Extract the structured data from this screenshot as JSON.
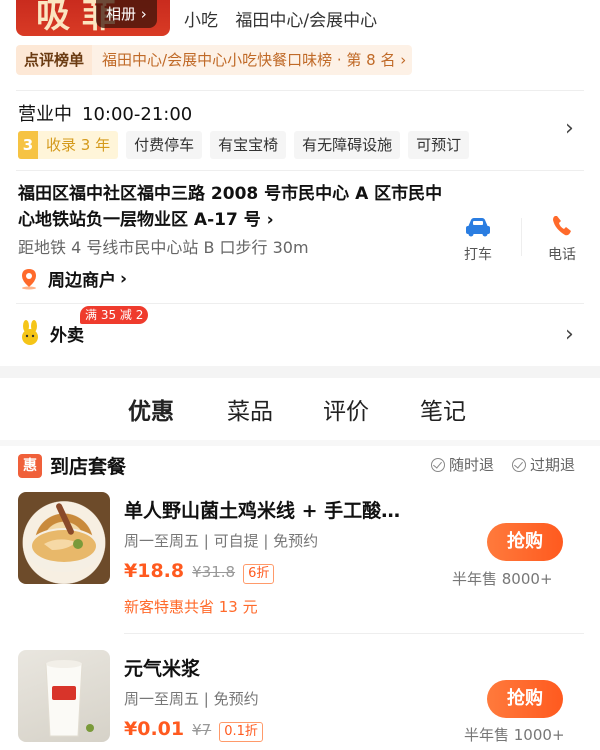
{
  "header": {
    "album_label": "相册",
    "categories": [
      "小吃",
      "福田中心/会展中心"
    ],
    "rank_tag": "点评榜单",
    "rank_text": "福田中心/会展中心小吃快餐口味榜 · 第 8 名"
  },
  "info": {
    "status": "营业中",
    "hours": "10:00-21:00",
    "years_num": "3",
    "years_text": "收录 3 年",
    "amenities": [
      "付费停车",
      "有宝宝椅",
      "有无障碍设施",
      "可预订"
    ],
    "address": "福田区福中社区福中三路 2008 号市民中心 A 区市民中心地铁站负一层物业区 A-17 号",
    "subway": "距地铁 4 号线市民中心站 B 口步行 30m",
    "taxi_label": "打车",
    "phone_label": "电话",
    "nearby_label": "周边商户",
    "takeout_label": "外卖",
    "takeout_promo": "满 35 减 2"
  },
  "tabs": [
    "优惠",
    "菜品",
    "评价",
    "笔记"
  ],
  "deals_section": {
    "icon_text": "惠",
    "title": "到店套餐",
    "guarantee_1": "随时退",
    "guarantee_2": "过期退"
  },
  "deals": [
    {
      "name": "单人野山菌土鸡米线 + 手工酸…",
      "meta": "周一至周五 | 可自提 | 免预约",
      "price": "¥18.8",
      "old_price": "¥31.8",
      "discount": "6折",
      "new_user": "新客特惠共省 13 元",
      "buy": "抢购",
      "sold": "半年售 8000+"
    },
    {
      "name": "元气米浆",
      "meta": "周一至周五 | 免预约",
      "price": "¥0.01",
      "old_price": "¥7",
      "discount": "0.1折",
      "buy": "抢购",
      "sold": "半年售 1000+"
    }
  ],
  "colors": {
    "accent": "#ff5a1f",
    "rank_text": "#c06a28",
    "hui": "#f0603a",
    "taxi_blue": "#2a7de1"
  }
}
